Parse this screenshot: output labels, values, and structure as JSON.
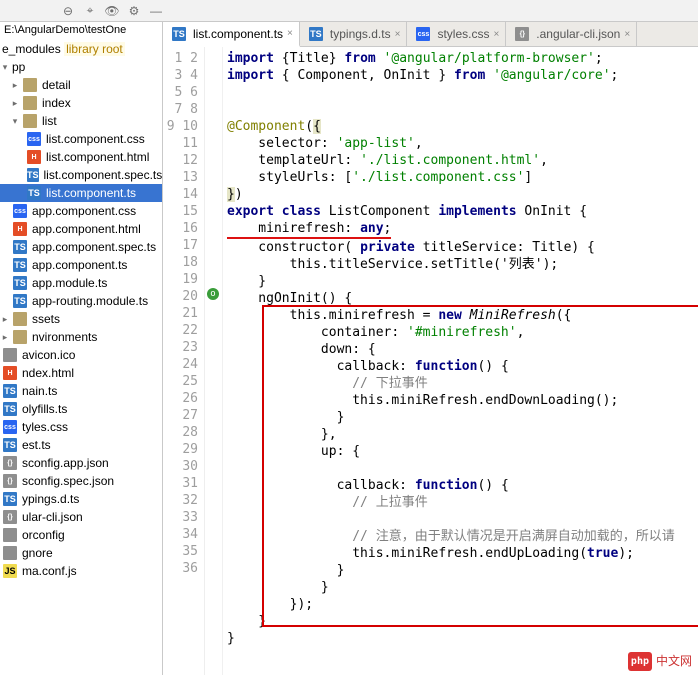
{
  "projectPath": "E:\\AngularDemo\\testOne",
  "tree": {
    "node_modules_label": "e_modules",
    "node_modules_hint": "library root",
    "pp_label": "pp",
    "folders": [
      {
        "name": "detail",
        "type": "folder"
      },
      {
        "name": "index",
        "type": "folder"
      }
    ],
    "list_label": "list",
    "list_children": [
      {
        "name": "list.component.css",
        "type": "css"
      },
      {
        "name": "list.component.html",
        "type": "html"
      },
      {
        "name": "list.component.spec.ts",
        "type": "ts"
      },
      {
        "name": "list.component.ts",
        "type": "ts",
        "selected": true
      }
    ],
    "pp_children": [
      {
        "name": "app.component.css",
        "type": "css"
      },
      {
        "name": "app.component.html",
        "type": "html"
      },
      {
        "name": "app.component.spec.ts",
        "type": "ts"
      },
      {
        "name": "app.component.ts",
        "type": "ts"
      },
      {
        "name": "app.module.ts",
        "type": "ts"
      },
      {
        "name": "app-routing.module.ts",
        "type": "ts"
      }
    ],
    "root_siblings": [
      {
        "name": "ssets",
        "type": "folder"
      },
      {
        "name": "nvironments",
        "type": "folder"
      },
      {
        "name": "avicon.ico",
        "type": "file"
      },
      {
        "name": "ndex.html",
        "type": "html"
      },
      {
        "name": "nain.ts",
        "type": "ts"
      },
      {
        "name": "olyfills.ts",
        "type": "ts"
      },
      {
        "name": "tyles.css",
        "type": "css"
      },
      {
        "name": "est.ts",
        "type": "ts"
      },
      {
        "name": "sconfig.app.json",
        "type": "json"
      },
      {
        "name": "sconfig.spec.json",
        "type": "json"
      },
      {
        "name": "ypings.d.ts",
        "type": "ts"
      },
      {
        "name": "ular-cli.json",
        "type": "json"
      },
      {
        "name": "orconfig",
        "type": "file"
      },
      {
        "name": "gnore",
        "type": "file"
      },
      {
        "name": "ma.conf.js",
        "type": "js"
      }
    ]
  },
  "tabs": [
    {
      "name": "list.component.ts",
      "type": "ts",
      "active": true
    },
    {
      "name": "typings.d.ts",
      "type": "ts"
    },
    {
      "name": "styles.css",
      "type": "css"
    },
    {
      "name": ".angular-cli.json",
      "type": "json"
    }
  ],
  "code": {
    "l1_a": "import",
    "l1_b": " {Title} ",
    "l1_c": "from",
    "l1_d": " '@angular/platform-browser'",
    "l2_a": "import",
    "l2_b": " { Component, OnInit } ",
    "l2_c": "from",
    "l2_d": " '@angular/core'",
    "l5_a": "@Component",
    "l5_b": "(",
    "l5_c": "{",
    "l6_a": "    selector: ",
    "l6_b": "'app-list'",
    "l6_c": ",",
    "l7_a": "    templateUrl: ",
    "l7_b": "'./list.component.html'",
    "l7_c": ",",
    "l8_a": "    styleUrls: [",
    "l8_b": "'./list.component.css'",
    "l8_c": "]",
    "l9_a": "}",
    "l9_b": ")",
    "l10_a": "export class ",
    "l10_b": "ListComponent ",
    "l10_c": "implements ",
    "l10_d": "OnInit {",
    "l11_a": "    minirefresh: ",
    "l11_b": "any",
    "l12_a": "    constructor( ",
    "l12_b": "private ",
    "l12_c": "titleService: Title) {",
    "l13": "        this.titleService.setTitle('列表');",
    "l14": "    }",
    "l15": "    ngOnInit() {",
    "l16_a": "        this.minirefresh = ",
    "l16_b": "new ",
    "l16_c": "MiniRefresh",
    "l16_d": "({",
    "l17_a": "            container: ",
    "l17_b": "'#minirefresh'",
    "l17_c": ",",
    "l18": "            down: {",
    "l19_a": "              callback: ",
    "l19_b": "function",
    "l19_c": "() {",
    "l20": "                // 下拉事件",
    "l21": "                this.miniRefresh.endDownLoading();",
    "l22": "              }",
    "l23": "            },",
    "l24": "            up: {",
    "l25": "",
    "l26_a": "              callback: ",
    "l26_b": "function",
    "l26_c": "() {",
    "l27": "                // 上拉事件",
    "l28": "",
    "l29": "                // 注意，由于默认情况是开启满屏自动加载的，所以请",
    "l30_a": "                this.miniRefresh.endUpLoading(",
    "l30_b": "true",
    "l30_c": ");",
    "l31": "              }",
    "l32": "            }",
    "l33": "        });",
    "l34": "    }",
    "l35": "}",
    "l36": ""
  },
  "lineCount": 36,
  "watermark": "中文网"
}
